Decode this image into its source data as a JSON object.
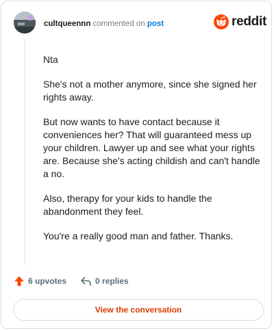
{
  "comment": {
    "username": "cultqueennn",
    "action_text": "commented on",
    "post_link": "post",
    "paragraphs": [
      "Nta",
      "She's not a mother anymore, since she signed her rights away.",
      "But now wants to have contact because it conveniences her? That will guaranteed mess up your children. Lawyer up and see what your rights are. Because she's acting childish and can't handle a no.",
      "Also, therapy for your kids to handle the abandonment they feel.",
      "You're a really good man and father. Thanks."
    ]
  },
  "brand": {
    "name": "reddit",
    "color": "#ff4500"
  },
  "actions": {
    "upvotes": "6 upvotes",
    "replies": "0 replies"
  },
  "cta": {
    "label": "View the conversation"
  },
  "icons": [
    "avatar",
    "reddit-logo-icon",
    "upvote-arrow-icon",
    "reply-icon"
  ]
}
